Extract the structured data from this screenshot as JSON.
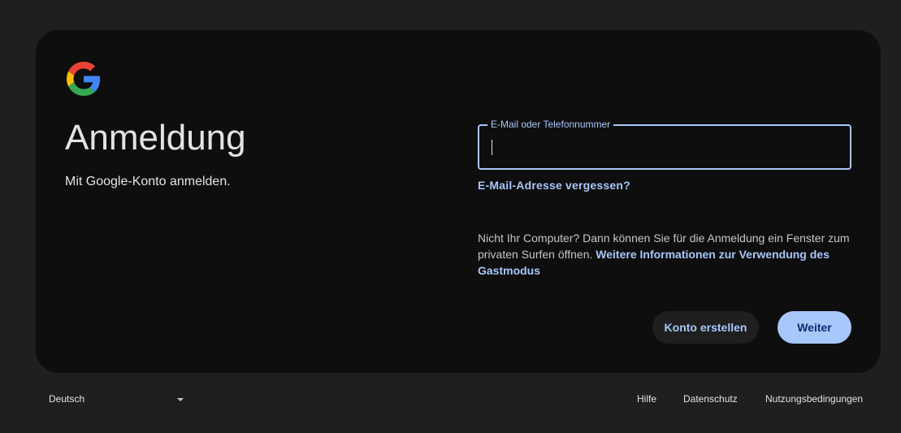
{
  "brand": {
    "logo_icon": "google-g-logo-icon",
    "colors": {
      "blue": "#4285F4",
      "red": "#EA4335",
      "yellow": "#FBBC05",
      "green": "#34A853"
    }
  },
  "signin": {
    "title": "Anmeldung",
    "subtitle": "Mit Google-Konto anmelden.",
    "email_field": {
      "label": "E-Mail oder Telefonnummer",
      "value": ""
    },
    "forgot_email_link": "E-Mail-Adresse vergessen?",
    "guest_notice": {
      "text": "Nicht Ihr Computer? Dann können Sie für die Anmeldung ein Fenster zum privaten Surfen öffnen. ",
      "link": "Weitere Informationen zur Verwendung des Gastmodus"
    },
    "create_account_button": "Konto erstellen",
    "next_button": "Weiter"
  },
  "footer": {
    "language": "Deutsch",
    "links": {
      "help": "Hilfe",
      "privacy": "Datenschutz",
      "terms": "Nutzungsbedingungen"
    }
  },
  "theme": {
    "page_bg": "#1f1f1f",
    "card_bg": "#0e0e0e",
    "accent": "#a8c7fa",
    "text": "#e3e3e3"
  }
}
